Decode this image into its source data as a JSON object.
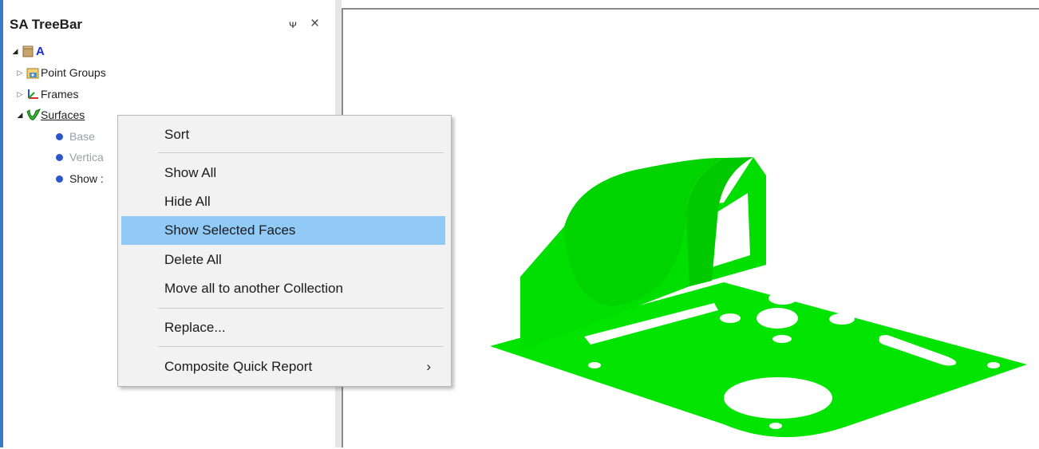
{
  "treebar": {
    "title": "SA TreeBar",
    "pin_glyph": "ᴪ",
    "close_glyph": "×",
    "root": {
      "label": "A"
    },
    "nodes": [
      {
        "label": "Point Groups",
        "icon": "point-groups-icon"
      },
      {
        "label": "Frames",
        "icon": "frames-icon"
      },
      {
        "label": "Surfaces",
        "icon": "surfaces-icon"
      }
    ],
    "children": [
      {
        "label": "Base"
      },
      {
        "label": "Vertica"
      },
      {
        "label": "Show :"
      }
    ]
  },
  "context_menu": {
    "items": [
      {
        "label": "Sort"
      },
      {
        "label": "Show All"
      },
      {
        "label": "Hide All"
      },
      {
        "label": "Show Selected Faces"
      },
      {
        "label": "Delete All"
      },
      {
        "label": "Move all to another Collection"
      },
      {
        "label": "Replace..."
      },
      {
        "label": "Composite Quick Report"
      }
    ],
    "submenu_arrow": "›"
  },
  "colors": {
    "part_green": "#00e400",
    "highlight": "#91c9f7",
    "accent": "#3a78c6"
  }
}
